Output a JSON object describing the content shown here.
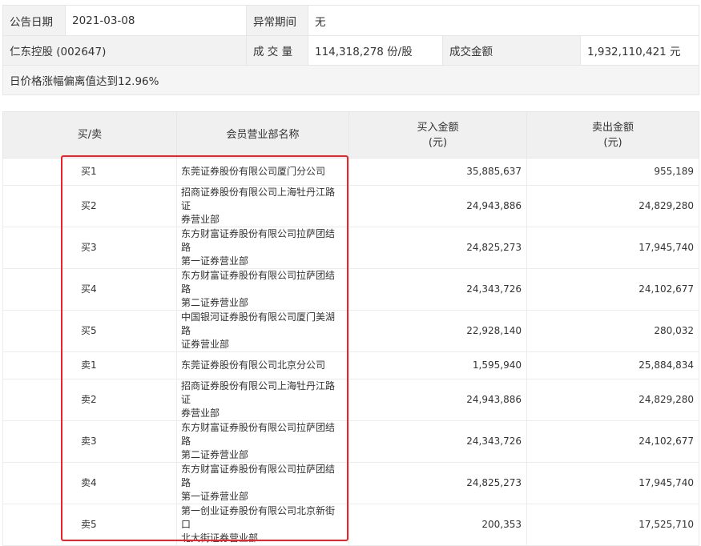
{
  "info": {
    "announce_date_label": "公告日期",
    "announce_date": "2021-03-08",
    "abnormal_period_label": "异常期间",
    "abnormal_period": "无",
    "stock_name": "仁东控股 (002647)",
    "volume_label": "成 交 量",
    "volume": "114,318,278 份/股",
    "turnover_label": "成交金额",
    "turnover": "1,932,110,421 元",
    "reason": "日价格涨幅偏离值达到12.96%"
  },
  "table": {
    "headers": {
      "side": "买/卖",
      "branch": "会员营业部名称",
      "buy_line1": "买入金额",
      "buy_line2": "(元)",
      "sell_line1": "卖出金额",
      "sell_line2": "(元)"
    },
    "rows": [
      {
        "side": "买1",
        "branch_line1": "东莞证券股份有限公司厦门分公司",
        "branch_line2": "",
        "buy": "35,885,637",
        "sell": "955,189"
      },
      {
        "side": "买2",
        "branch_line1": "招商证券股份有限公司上海牡丹江路证",
        "branch_line2": "券营业部",
        "buy": "24,943,886",
        "sell": "24,829,280"
      },
      {
        "side": "买3",
        "branch_line1": "东方财富证券股份有限公司拉萨团结路",
        "branch_line2": "第一证券营业部",
        "buy": "24,825,273",
        "sell": "17,945,740"
      },
      {
        "side": "买4",
        "branch_line1": "东方财富证券股份有限公司拉萨团结路",
        "branch_line2": "第二证券营业部",
        "buy": "24,343,726",
        "sell": "24,102,677"
      },
      {
        "side": "买5",
        "branch_line1": "中国银河证券股份有限公司厦门美湖路",
        "branch_line2": "证券营业部",
        "buy": "22,928,140",
        "sell": "280,032"
      },
      {
        "side": "卖1",
        "branch_line1": "东莞证券股份有限公司北京分公司",
        "branch_line2": "",
        "buy": "1,595,940",
        "sell": "25,884,834"
      },
      {
        "side": "卖2",
        "branch_line1": "招商证券股份有限公司上海牡丹江路证",
        "branch_line2": "券营业部",
        "buy": "24,943,886",
        "sell": "24,829,280"
      },
      {
        "side": "卖3",
        "branch_line1": "东方财富证券股份有限公司拉萨团结路",
        "branch_line2": "第二证券营业部",
        "buy": "24,343,726",
        "sell": "24,102,677"
      },
      {
        "side": "卖4",
        "branch_line1": "东方财富证券股份有限公司拉萨团结路",
        "branch_line2": "第一证券营业部",
        "buy": "24,825,273",
        "sell": "17,945,740"
      },
      {
        "side": "卖5",
        "branch_line1": "第一创业证券股份有限公司北京新街口",
        "branch_line2": "北大街证券营业部",
        "buy": "200,353",
        "sell": "17,525,710"
      }
    ]
  },
  "highlight_color": "#e8252a"
}
